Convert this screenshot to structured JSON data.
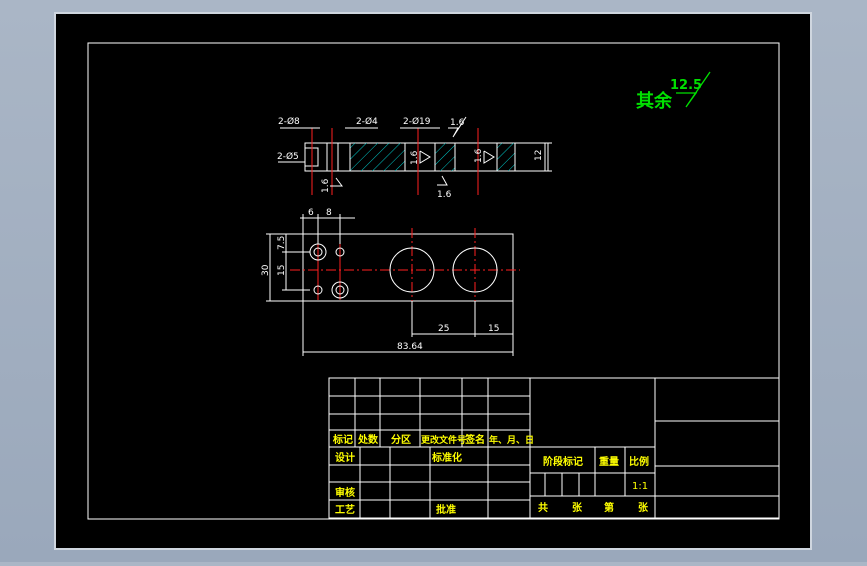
{
  "roughness_note": {
    "prefix": "其余",
    "value": "12.5"
  },
  "section_view": {
    "dim_hole_8": "2-Ø8",
    "dim_hole_4": "2-Ø4",
    "dim_hole_5": "2-Ø5",
    "dim_hole_19": "2-Ø19",
    "dim_thickness": "12",
    "roughness_top": "1.6",
    "roughness_bottom": "1.6",
    "roughness_left": "1.6",
    "roughness_mid": "1.6",
    "roughness_right": "1.6"
  },
  "plan_view": {
    "dim_6": "6",
    "dim_8": "8",
    "dim_7_5": "7.5",
    "dim_15_left": "15",
    "dim_30": "30",
    "dim_25": "25",
    "dim_15_bottom": "15",
    "dim_overall": "83.64"
  },
  "title_block": {
    "col_mark": "标记",
    "col_count": "处数",
    "col_zone": "分区",
    "col_change_doc": "更改文件号",
    "col_sign": "签名",
    "col_date": "年、月、日",
    "design": "设计",
    "standardize": "标准化",
    "review": "审核",
    "process": "工艺",
    "approve": "批准",
    "stage_mark": "阶段标记",
    "weight": "重量",
    "scale": "比例",
    "scale_value": "1:1",
    "total": "共",
    "sheet": "张",
    "number": "第",
    "sheet2": "张"
  }
}
